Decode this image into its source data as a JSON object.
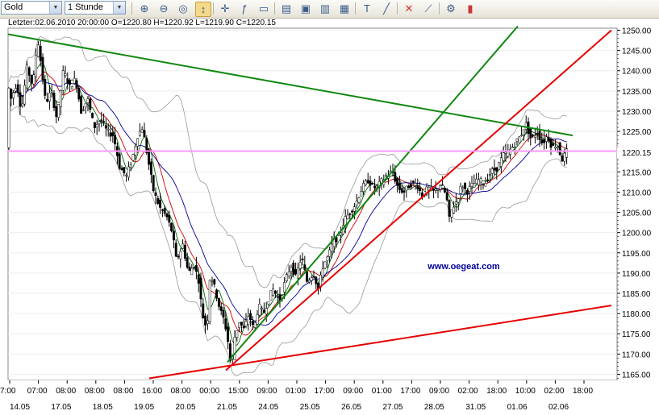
{
  "toolbar": {
    "symbol": "Gold",
    "interval": "1 Stunde",
    "icons": [
      "zoom-in-icon",
      "zoom-out-icon",
      "zoom-fit-icon",
      "cursor-move-icon",
      "crosshair-icon",
      "formula-icon",
      "window-icon",
      "print-icon",
      "save-icon",
      "export-icon",
      "image-export-icon",
      "text-tool-icon",
      "line-tool-icon",
      "fibonacci-icon",
      "trend-tool-icon",
      "settings-icon",
      "candle-type-icon"
    ]
  },
  "info_line": "Letzter:02.06.2010 20:00:00 O=1220.80 H=1220.92 L=1219.90 C=1220.15",
  "watermark": "www.oegeat.com",
  "price_tag": "1220.15",
  "colors": {
    "green_trendline": "#118811",
    "red_trendline": "#e60000",
    "price_line": "#ff99ff",
    "watermark": "#000099",
    "candle_up": "#ffffff",
    "candle_down": "#000000",
    "ma_red": "#cc0000",
    "ma_green": "#006600",
    "ma_blue": "#000099",
    "bollinger": "#999999"
  },
  "chart_data": {
    "type": "candlestick",
    "ylim": [
      1163.5,
      1250.5
    ],
    "yticks": [
      "1250.00",
      "1245.00",
      "1240.00",
      "1235.00",
      "1230.00",
      "1225.00",
      "1220.00",
      "1215.00",
      "1210.00",
      "1205.00",
      "1200.00",
      "1195.00",
      "1190.00",
      "1185.00",
      "1180.00",
      "1175.00",
      "1170.00",
      "1165.00"
    ],
    "x_time_labels": [
      "7:00",
      "07:00",
      "08:00",
      "08:00",
      "08:00",
      "16:00",
      "08:00",
      "00:00",
      "15:00",
      "09:00",
      "01:00",
      "17:00",
      "09:00",
      "01:00",
      "17:00",
      "09:00",
      "02:00",
      "18:00",
      "10:00",
      "02:00",
      "18:00"
    ],
    "x_date_labels": [
      "14.05",
      "17.05",
      "18.05",
      "19.05",
      "20.05",
      "21.05",
      "24.05",
      "25.05",
      "26.05",
      "27.05",
      "28.05",
      "31.05",
      "01.06",
      "02.06"
    ],
    "last_close": 1220.15,
    "price_path": [
      [
        0,
        1238
      ],
      [
        5,
        1233
      ],
      [
        12,
        1237
      ],
      [
        18,
        1230
      ],
      [
        25,
        1241
      ],
      [
        32,
        1236
      ],
      [
        38,
        1248
      ],
      [
        42,
        1242
      ],
      [
        48,
        1232
      ],
      [
        55,
        1235
      ],
      [
        62,
        1228
      ],
      [
        70,
        1240
      ],
      [
        78,
        1236
      ],
      [
        85,
        1238
      ],
      [
        92,
        1230
      ],
      [
        100,
        1233
      ],
      [
        108,
        1226
      ],
      [
        116,
        1228
      ],
      [
        124,
        1225
      ],
      [
        132,
        1224
      ],
      [
        140,
        1216
      ],
      [
        148,
        1214
      ],
      [
        155,
        1218
      ],
      [
        162,
        1224
      ],
      [
        168,
        1226
      ],
      [
        175,
        1218
      ],
      [
        182,
        1210
      ],
      [
        190,
        1206
      ],
      [
        198,
        1204
      ],
      [
        205,
        1200
      ],
      [
        210,
        1193
      ],
      [
        218,
        1197
      ],
      [
        225,
        1190
      ],
      [
        232,
        1192
      ],
      [
        238,
        1188
      ],
      [
        242,
        1180
      ],
      [
        248,
        1176
      ],
      [
        252,
        1190
      ],
      [
        258,
        1186
      ],
      [
        264,
        1181
      ],
      [
        270,
        1178
      ],
      [
        275,
        1172
      ],
      [
        278,
        1166
      ],
      [
        282,
        1174
      ],
      [
        288,
        1178
      ],
      [
        294,
        1176
      ],
      [
        300,
        1180
      ],
      [
        306,
        1176
      ],
      [
        312,
        1182
      ],
      [
        318,
        1180
      ],
      [
        325,
        1184
      ],
      [
        330,
        1186
      ],
      [
        338,
        1183
      ],
      [
        345,
        1188
      ],
      [
        352,
        1192
      ],
      [
        358,
        1189
      ],
      [
        365,
        1194
      ],
      [
        372,
        1188
      ],
      [
        380,
        1190
      ],
      [
        386,
        1186
      ],
      [
        392,
        1192
      ],
      [
        398,
        1194
      ],
      [
        405,
        1198
      ],
      [
        412,
        1199
      ],
      [
        418,
        1203
      ],
      [
        425,
        1205
      ],
      [
        432,
        1207
      ],
      [
        440,
        1211
      ],
      [
        448,
        1213
      ],
      [
        455,
        1211
      ],
      [
        462,
        1212
      ],
      [
        470,
        1214
      ],
      [
        478,
        1215
      ],
      [
        485,
        1211
      ],
      [
        492,
        1210
      ],
      [
        500,
        1212
      ],
      [
        508,
        1212
      ],
      [
        515,
        1209
      ],
      [
        522,
        1211
      ],
      [
        530,
        1210
      ],
      [
        538,
        1212
      ],
      [
        545,
        1209
      ],
      [
        548,
        1203
      ],
      [
        552,
        1206
      ],
      [
        558,
        1208
      ],
      [
        564,
        1212
      ],
      [
        570,
        1210
      ],
      [
        578,
        1212
      ],
      [
        585,
        1213
      ],
      [
        592,
        1212
      ],
      [
        600,
        1215
      ],
      [
        608,
        1216
      ],
      [
        615,
        1219
      ],
      [
        622,
        1220
      ],
      [
        630,
        1222
      ],
      [
        637,
        1224
      ],
      [
        643,
        1227
      ],
      [
        650,
        1223
      ],
      [
        657,
        1225
      ],
      [
        664,
        1222
      ],
      [
        670,
        1224
      ],
      [
        676,
        1221
      ],
      [
        682,
        1222
      ],
      [
        688,
        1218
      ],
      [
        694,
        1220
      ],
      [
        700,
        1221
      ]
    ],
    "trendlines": [
      {
        "color": "green",
        "from": [
          0,
          1249
        ],
        "to": [
          700,
          1224
        ]
      },
      {
        "color": "green",
        "from": [
          272,
          1168
        ],
        "to": [
          632,
          1251
        ]
      },
      {
        "color": "red",
        "from": [
          175,
          1164
        ],
        "to": [
          748,
          1182
        ]
      },
      {
        "color": "red",
        "from": [
          270,
          1166
        ],
        "to": [
          748,
          1250
        ]
      }
    ]
  }
}
